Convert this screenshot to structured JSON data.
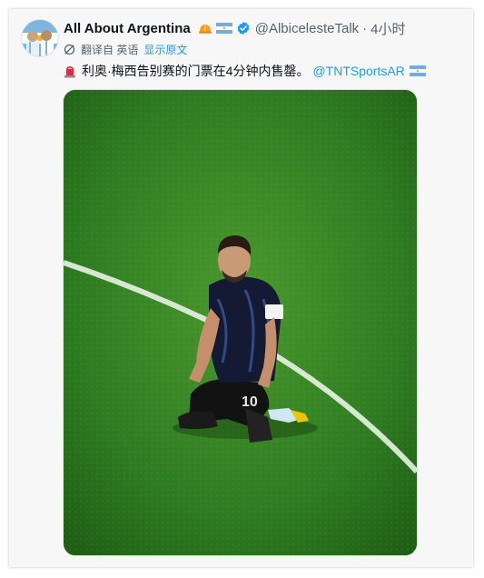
{
  "tweet": {
    "author_name": "All About Argentina",
    "author_emojis": [
      "helmet-icon",
      "argentina-flag-icon"
    ],
    "verified": true,
    "handle": "@AlbicelesteTalk",
    "separator": "·",
    "time": "4小时",
    "translation": {
      "label": "翻译自 英语",
      "show_original": "显示原文"
    },
    "text": "利奥·梅西告别赛的门票在4分钟内售罄。",
    "mention": "@TNTSportsAR",
    "text_emojis": [
      "siren-icon",
      "argentina-flag-icon"
    ],
    "media": {
      "jersey_number": "10"
    }
  },
  "colors": {
    "link": "#1d9bf0",
    "text_primary": "#0f1419",
    "text_secondary": "#536471",
    "verified": "#1d9bf0",
    "pitch": "#2f7d22"
  }
}
